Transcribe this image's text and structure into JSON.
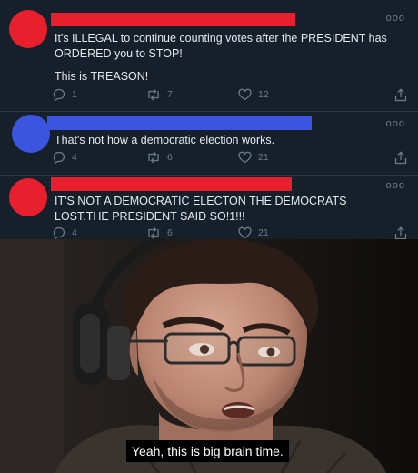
{
  "tweets": [
    {
      "avatar_color": "#e8202e",
      "name_bar_color": "#e8202e",
      "lines": [
        "It's ILLEGAL to continue counting votes after the PRESIDENT has ORDERED you to STOP!",
        "This is TREASON!"
      ],
      "replies": "1",
      "retweets": "7",
      "likes": "12"
    },
    {
      "avatar_color": "#3b55e0",
      "name_bar_color": "#3b55e0",
      "lines": [
        "That's not how a democratic election works."
      ],
      "replies": "4",
      "retweets": "6",
      "likes": "21"
    },
    {
      "avatar_color": "#e8202e",
      "name_bar_color": "#e8202e",
      "lines": [
        "IT'S NOT A DEMOCRATIC ELECTON THE DEMOCRATS LOST.THE PRESIDENT SAID SO!1!!!"
      ],
      "replies": "4",
      "retweets": "6",
      "likes": "21"
    }
  ],
  "more_glyph": "ooo",
  "icons": {
    "reply": "reply-icon",
    "retweet": "retweet-icon",
    "like": "heart-icon",
    "share": "share-icon"
  },
  "meme": {
    "caption": "Yeah, this is big brain time."
  }
}
